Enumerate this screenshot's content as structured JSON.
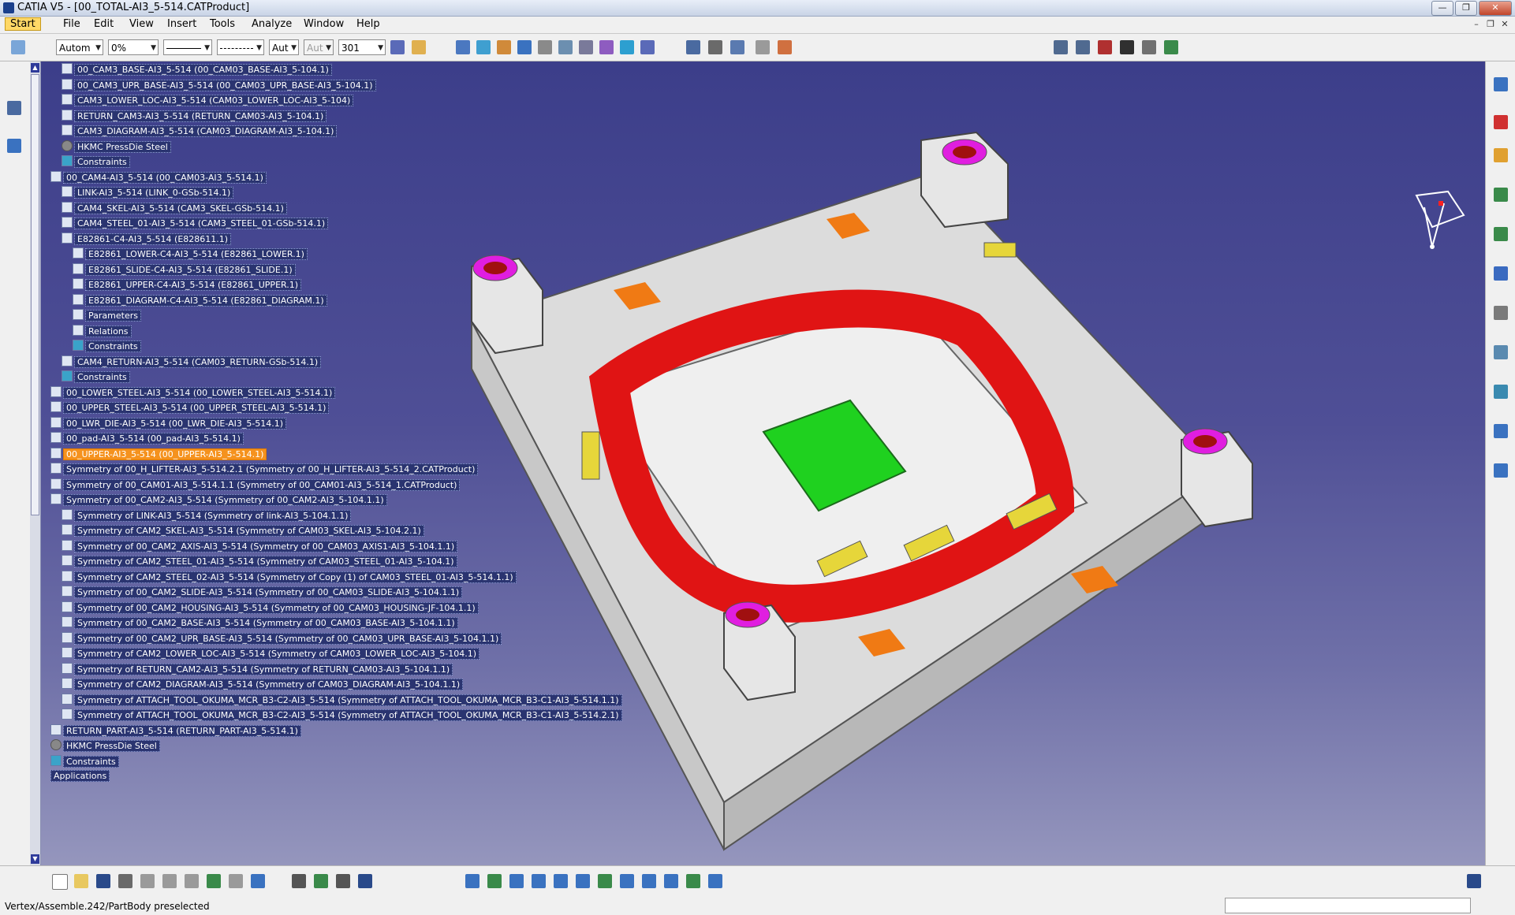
{
  "window": {
    "title": "CATIA V5 - [00_TOTAL-AI3_5-514.CATProduct]"
  },
  "menu": {
    "items": [
      "Start",
      "File",
      "Edit",
      "View",
      "Insert",
      "Tools",
      "Analyze",
      "Window",
      "Help"
    ]
  },
  "toolbar": {
    "fill_color": "Autom",
    "transparency": "0%",
    "line_type": "Aut",
    "layer_disabled": "Aut",
    "layer": "301"
  },
  "tree": {
    "nodes": [
      {
        "label": "00_CAM3_BASE-AI3_5-514 (00_CAM03_BASE-AI3_5-104.1)",
        "icon": "part"
      },
      {
        "label": "00_CAM3_UPR_BASE-AI3_5-514 (00_CAM03_UPR_BASE-AI3_5-104.1)",
        "icon": "part"
      },
      {
        "label": "CAM3_LOWER_LOC-AI3_5-514 (CAM03_LOWER_LOC-AI3_5-104)",
        "icon": "part"
      },
      {
        "label": "RETURN_CAM3-AI3_5-514 (RETURN_CAM03-AI3_5-104.1)",
        "icon": "part"
      },
      {
        "label": "CAM3_DIAGRAM-AI3_5-514 (CAM03_DIAGRAM-AI3_5-104.1)",
        "icon": "part"
      },
      {
        "label": "HKMC PressDie Steel",
        "icon": "material"
      },
      {
        "label": "Constraints",
        "icon": "constraints"
      },
      {
        "label": "00_CAM4-AI3_5-514 (00_CAM03-AI3_5-514.1)",
        "icon": "product"
      },
      {
        "label": "LINK-AI3_5-514 (LINK_0-GSb-514.1)",
        "icon": "part"
      },
      {
        "label": "CAM4_SKEL-AI3_5-514 (CAM3_SKEL-GSb-514.1)",
        "icon": "part"
      },
      {
        "label": "CAM4_STEEL_01-AI3_5-514 (CAM3_STEEL_01-GSb-514.1)",
        "icon": "part"
      },
      {
        "label": "E82861-C4-AI3_5-514 (E828611.1)",
        "icon": "product"
      },
      {
        "label": "E82861_LOWER-C4-AI3_5-514 (E82861_LOWER.1)",
        "icon": "part"
      },
      {
        "label": "E82861_SLIDE-C4-AI3_5-514 (E82861_SLIDE.1)",
        "icon": "part"
      },
      {
        "label": "E82861_UPPER-C4-AI3_5-514 (E82861_UPPER.1)",
        "icon": "part"
      },
      {
        "label": "E82861_DIAGRAM-C4-AI3_5-514 (E82861_DIAGRAM.1)",
        "icon": "part"
      },
      {
        "label": "Parameters",
        "icon": "parameters"
      },
      {
        "label": "Relations",
        "icon": "relations"
      },
      {
        "label": "Constraints",
        "icon": "constraints"
      },
      {
        "label": "CAM4_RETURN-AI3_5-514 (CAM03_RETURN-GSb-514.1)",
        "icon": "part"
      },
      {
        "label": "Constraints",
        "icon": "constraints"
      },
      {
        "label": "00_LOWER_STEEL-AI3_5-514 (00_LOWER_STEEL-AI3_5-514.1)",
        "icon": "product"
      },
      {
        "label": "00_UPPER_STEEL-AI3_5-514 (00_UPPER_STEEL-AI3_5-514.1)",
        "icon": "product"
      },
      {
        "label": "00_LWR_DIE-AI3_5-514 (00_LWR_DIE-AI3_5-514.1)",
        "icon": "product"
      },
      {
        "label": "00_pad-AI3_5-514 (00_pad-AI3_5-514.1)",
        "icon": "product"
      },
      {
        "label": "00_UPPER-AI3_5-514 (00_UPPER-AI3_5-514.1)",
        "icon": "product",
        "selected": true
      },
      {
        "label": "Symmetry of 00_H_LIFTER-AI3_5-514.2.1 (Symmetry of 00_H_LIFTER-AI3_5-514_2.CATProduct)",
        "icon": "product"
      },
      {
        "label": "Symmetry of 00_CAM01-AI3_5-514.1.1 (Symmetry of 00_CAM01-AI3_5-514_1.CATProduct)",
        "icon": "product"
      },
      {
        "label": "Symmetry of 00_CAM2-AI3_5-514 (Symmetry of 00_CAM2-AI3_5-104.1.1)",
        "icon": "product"
      },
      {
        "label": "Symmetry of LINK-AI3_5-514 (Symmetry of link-AI3_5-104.1.1)",
        "icon": "part"
      },
      {
        "label": "Symmetry of CAM2_SKEL-AI3_5-514 (Symmetry of CAM03_SKEL-AI3_5-104.2.1)",
        "icon": "part"
      },
      {
        "label": "Symmetry of 00_CAM2_AXIS-AI3_5-514 (Symmetry of 00_CAM03_AXIS1-AI3_5-104.1.1)",
        "icon": "part"
      },
      {
        "label": "Symmetry of CAM2_STEEL_01-AI3_5-514 (Symmetry of CAM03_STEEL_01-AI3_5-104.1)",
        "icon": "part"
      },
      {
        "label": "Symmetry of CAM2_STEEL_02-AI3_5-514 (Symmetry of Copy (1) of CAM03_STEEL_01-AI3_5-514.1.1)",
        "icon": "part"
      },
      {
        "label": "Symmetry of 00_CAM2_SLIDE-AI3_5-514 (Symmetry of 00_CAM03_SLIDE-AI3_5-104.1.1)",
        "icon": "part"
      },
      {
        "label": "Symmetry of 00_CAM2_HOUSING-AI3_5-514 (Symmetry of 00_CAM03_HOUSING-JF-104.1.1)",
        "icon": "part"
      },
      {
        "label": "Symmetry of 00_CAM2_BASE-AI3_5-514 (Symmetry of 00_CAM03_BASE-AI3_5-104.1.1)",
        "icon": "part"
      },
      {
        "label": "Symmetry of 00_CAM2_UPR_BASE-AI3_5-514 (Symmetry of 00_CAM03_UPR_BASE-AI3_5-104.1.1)",
        "icon": "part"
      },
      {
        "label": "Symmetry of CAM2_LOWER_LOC-AI3_5-514 (Symmetry of CAM03_LOWER_LOC-AI3_5-104.1)",
        "icon": "part"
      },
      {
        "label": "Symmetry of RETURN_CAM2-AI3_5-514 (Symmetry of RETURN_CAM03-AI3_5-104.1.1)",
        "icon": "part"
      },
      {
        "label": "Symmetry of CAM2_DIAGRAM-AI3_5-514 (Symmetry of CAM03_DIAGRAM-AI3_5-104.1.1)",
        "icon": "part"
      },
      {
        "label": "Symmetry of ATTACH_TOOL_OKUMA_MCR_B3-C2-AI3_5-514 (Symmetry of ATTACH_TOOL_OKUMA_MCR_B3-C1-AI3_5-514.1.1)",
        "icon": "part"
      },
      {
        "label": "Symmetry of ATTACH_TOOL_OKUMA_MCR_B3-C2-AI3_5-514 (Symmetry of ATTACH_TOOL_OKUMA_MCR_B3-C1-AI3_5-514.2.1)",
        "icon": "part"
      },
      {
        "label": "RETURN_PART-AI3_5-514 (RETURN_PART-AI3_5-514.1)",
        "icon": "product"
      },
      {
        "label": "HKMC PressDie Steel",
        "icon": "material"
      },
      {
        "label": "Constraints",
        "icon": "constraints"
      },
      {
        "label": "Applications",
        "icon": "none"
      }
    ]
  },
  "status": {
    "message": "Vertex/Assemble.242/PartBody preselected"
  },
  "colors": {
    "viewport_top": "#3c3e8a",
    "viewport_bottom": "#9596bd",
    "selection": "#f5921e",
    "die_red": "#e01414",
    "die_magenta": "#e01ee0"
  }
}
